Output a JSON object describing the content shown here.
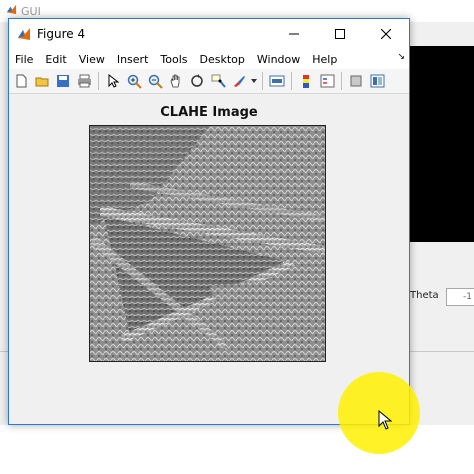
{
  "background_window": {
    "title": "GUI",
    "theta_label": "Theta",
    "theta_value": "-1"
  },
  "figure_window": {
    "title": "Figure 4",
    "menu": [
      "File",
      "Edit",
      "View",
      "Insert",
      "Tools",
      "Desktop",
      "Window",
      "Help"
    ],
    "toolbar_icons": [
      "new-figure-icon",
      "open-file-icon",
      "save-icon",
      "print-icon",
      "pointer-icon",
      "zoom-in-icon",
      "zoom-out-icon",
      "pan-icon",
      "rotate-3d-icon",
      "data-cursor-icon",
      "brush-icon",
      "link-plot-icon",
      "colorbar-icon",
      "legend-icon",
      "hide-plot-tools-icon",
      "show-plot-tools-icon"
    ]
  },
  "plot": {
    "title": "CLAHE Image"
  },
  "colors": {
    "window_border": "#2b79d0",
    "cursor_highlight": "#fff000"
  }
}
